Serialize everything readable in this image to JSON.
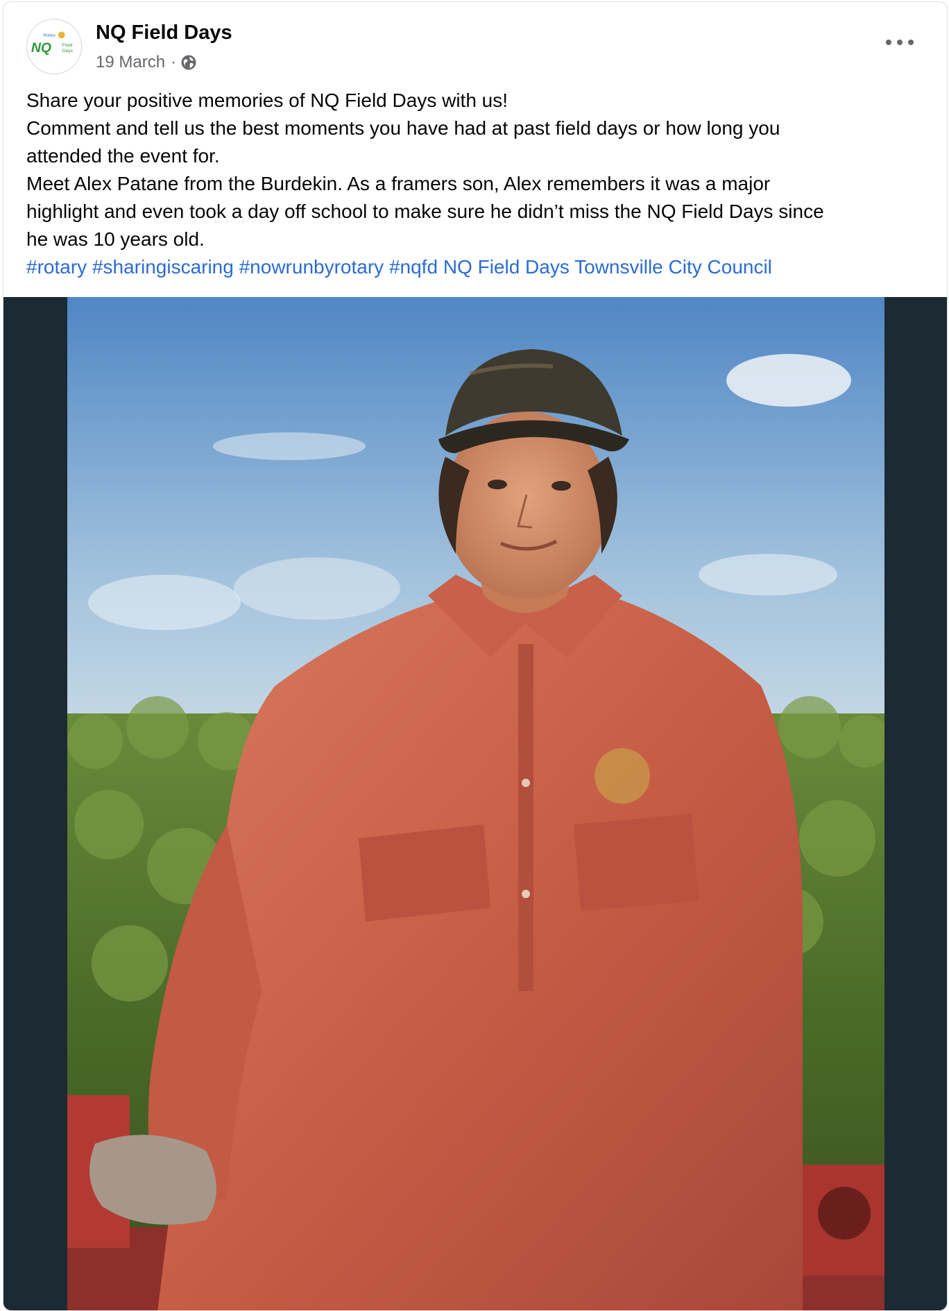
{
  "post": {
    "page_name": "NQ Field Days",
    "date": "19 March",
    "separator": "·",
    "privacy_icon": "globe-icon",
    "more_icon": "ellipsis-icon",
    "avatar_logo": {
      "top_text": "Rotary",
      "main_text": "NQ",
      "sub_text_1": "Field",
      "sub_text_2": "Days"
    },
    "text_lines": [
      "Share your positive memories of NQ Field Days with us!",
      "Comment and tell us the best moments you have had at past field days or how long you",
      "attended the event for.",
      "Meet Alex Patane from the Burdekin. As a framers son, Alex remembers it was a major",
      "highlight and even took a day off school to make sure he didn’t miss the NQ Field Days since",
      "he was 10 years old."
    ],
    "tags": [
      "#rotary",
      "#sharingiscaring",
      "#nowrunbyrotary",
      "#nqfd",
      "NQ Field Days",
      "Townsville City Council"
    ],
    "photo": {
      "description_name": "post-photo"
    }
  },
  "colors": {
    "link": "#2b6bd3",
    "text": "#050505",
    "meta": "#65676b",
    "photo_border": "#1c2a33",
    "logo_green": "#2f9a3a",
    "logo_blue": "#1f5fa8",
    "logo_gold": "#e7b23a"
  }
}
